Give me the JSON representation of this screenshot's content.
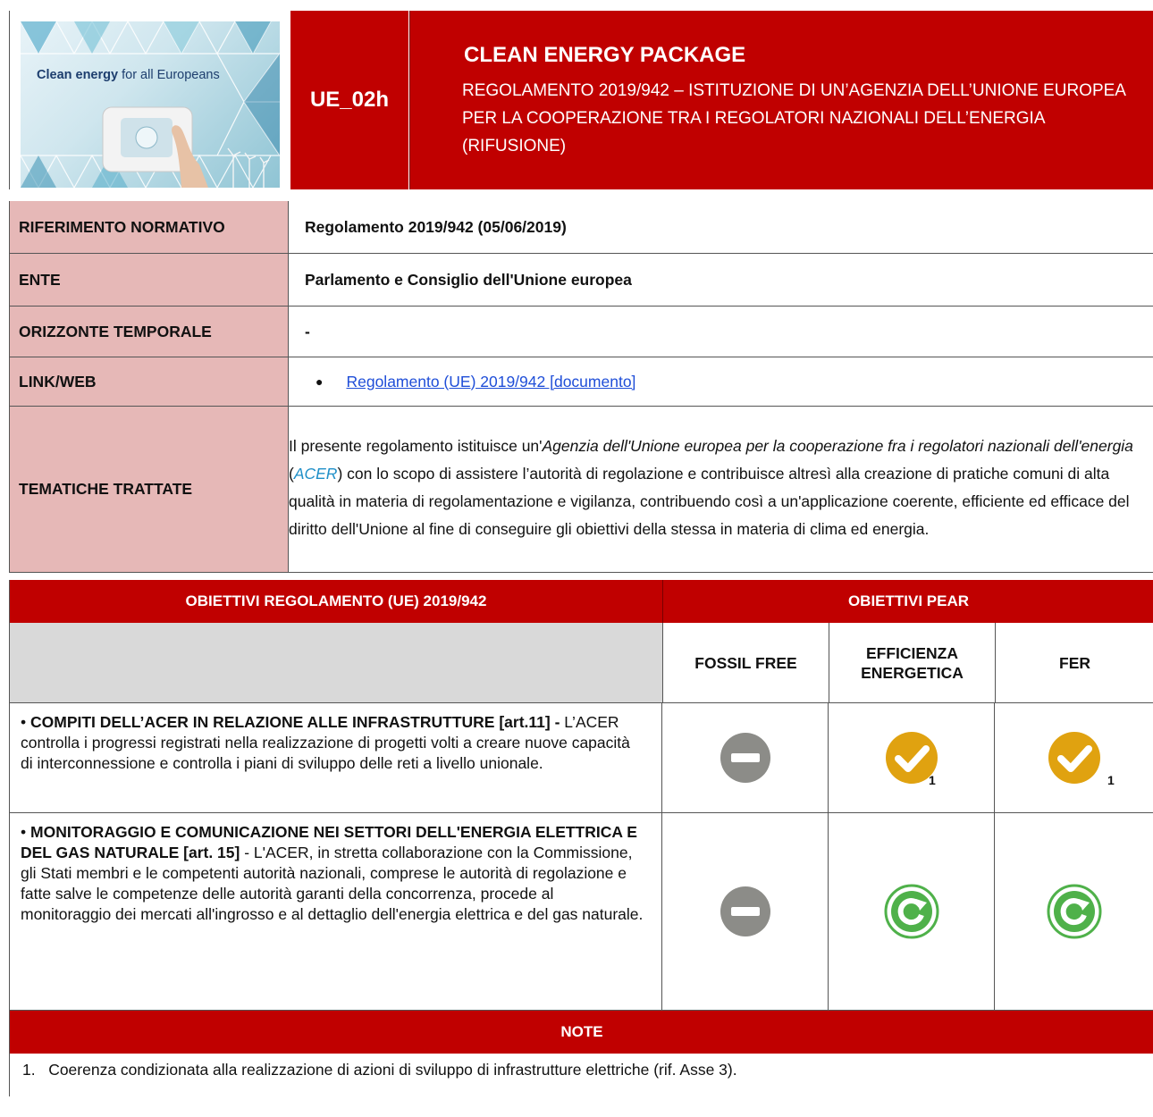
{
  "header": {
    "logo_text_bold": "Clean energy",
    "logo_text_rest": " for all Europeans",
    "code": "UE_02h",
    "package": "CLEAN ENERGY PACKAGE",
    "subtitle": "REGOLAMENTO 2019/942 – ISTITUZIONE DI UN’AGENZIA DELL’UNIONE EUROPEA PER LA COOPERAZIONE TRA I REGOLATORI NAZIONALI DELL’ENERGIA (RIFUSIONE)"
  },
  "info": {
    "riferimento_label": "RIFERIMENTO NORMATIVO",
    "riferimento_value": "Regolamento 2019/942 (05/06/2019)",
    "ente_label": "ENTE",
    "ente_value": "Parlamento e Consiglio dell'Unione europea",
    "orizzonte_label": "ORIZZONTE TEMPORALE",
    "orizzonte_value": "-",
    "link_label": "LINK/WEB",
    "link_text": "Regolamento (UE) 2019/942 [documento]",
    "tematiche_label": "TEMATICHE TRATTATE",
    "tematiche_p1": "Il presente regolamento istituisce un'",
    "tematiche_it1": "Agenzia dell'Unione europea per la cooperazione fra i regolatori nazionali dell'energia",
    "tematiche_p2": " (",
    "tematiche_acer": "ACER",
    "tematiche_p3": ") con lo scopo di assistere l’autorità di regolazione e contribuisce altresì alla creazione di pratiche comuni di alta qualità in materia di regolamentazione e vigilanza, contribuendo così a un'applicazione coerente, efficiente ed efficace del diritto dell'Unione al fine di conseguire gli obiettivi della stessa in materia di clima ed energia."
  },
  "table": {
    "head_left": "OBIETTIVI REGOLAMENTO (UE) 2019/942",
    "head_right": "OBIETTIVI PEAR",
    "col1": "FOSSIL FREE",
    "col2_line1": "EFFICIENZA",
    "col2_line2": "ENERGETICA",
    "col3": "FER",
    "rows": [
      {
        "title": "COMPITI DELL’ACER IN RELAZIONE ALLE INFRASTRUTTURE [art.11] -",
        "text": " L’ACER controlla i progressi registrati nella realizzazione di progetti volti a creare nuove capacità di interconnessione e controlla i piani di sviluppo delle reti a livello unionale.",
        "icons": [
          "minus-icon",
          "check-icon",
          "check-icon"
        ],
        "note_ref": "1"
      },
      {
        "title": "MONITORAGGIO E COMUNICAZIONE NEI SETTORI DELL'ENERGIA ELETTRICA E DEL GAS NATURALE [art. 15]",
        "text": " - L'ACER, in stretta collaborazione con la Commissione, gli Stati membri e le competenti autorità nazionali, comprese le autorità di regolazione e fatte salve le competenze delle autorità garanti della concorrenza, procede al monitoraggio dei mercati all'ingrosso e al dettaglio dell'energia elettrica e del gas naturale.",
        "icons": [
          "minus-icon",
          "refresh-icon",
          "refresh-icon"
        ]
      }
    ]
  },
  "notes": {
    "head": "NOTE",
    "items": [
      "Coerenza condizionata alla realizzazione di azioni di sviluppo di infrastrutture elettriche (rif. Asse 3)."
    ]
  },
  "colors": {
    "red": "#c00000",
    "label_pink": "#e6b8b7",
    "gray_icon": "#8c8c88",
    "gold_icon": "#e0a210",
    "green_icon": "#4fb14a"
  }
}
